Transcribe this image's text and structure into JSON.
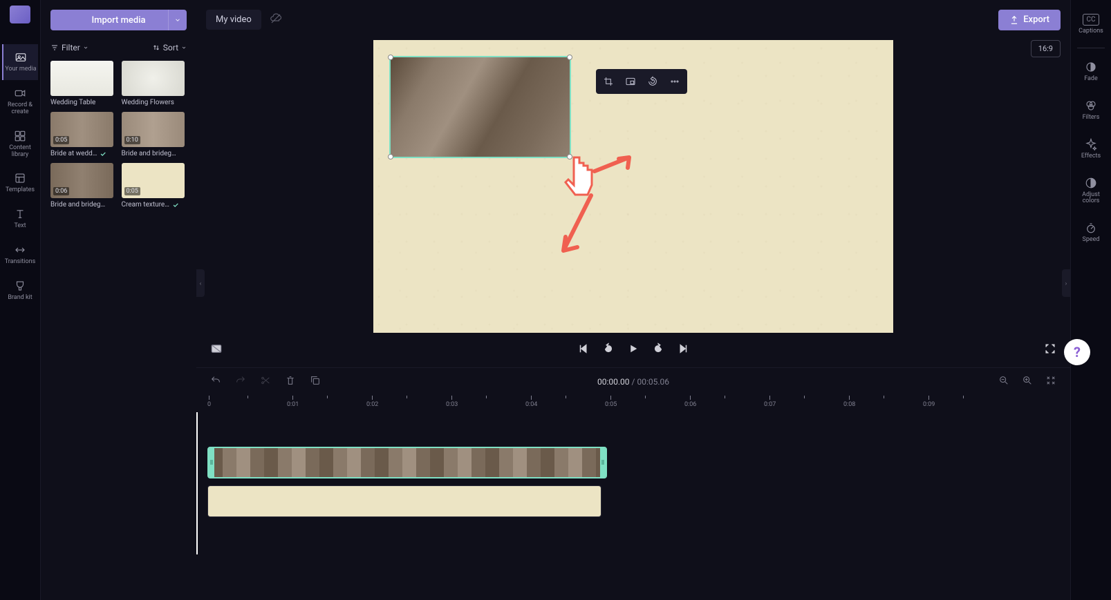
{
  "app": {
    "title": "My video"
  },
  "leftNav": {
    "items": [
      {
        "label": "Your media"
      },
      {
        "label": "Record & create"
      },
      {
        "label": "Content library"
      },
      {
        "label": "Templates"
      },
      {
        "label": "Text"
      },
      {
        "label": "Transitions"
      },
      {
        "label": "Brand kit"
      }
    ]
  },
  "mediaPanel": {
    "importLabel": "Import media",
    "filterLabel": "Filter",
    "sortLabel": "Sort",
    "items": [
      {
        "label": "Wedding Table",
        "duration": ""
      },
      {
        "label": "Wedding Flowers",
        "duration": ""
      },
      {
        "label": "Bride at wedd…",
        "duration": "0:05",
        "used": true
      },
      {
        "label": "Bride and brideg…",
        "duration": "0:10"
      },
      {
        "label": "Bride and brideg…",
        "duration": "0:06"
      },
      {
        "label": "Cream texture…",
        "duration": "0:05",
        "used": true
      }
    ]
  },
  "topBar": {
    "exportLabel": "Export",
    "aspectLabel": "16:9"
  },
  "playback": {
    "currentTime": "00:00.00",
    "separator": " / ",
    "totalTime": "00:05.06"
  },
  "ruler": {
    "ticks": [
      "0",
      "0:01",
      "0:02",
      "0:03",
      "0:04",
      "0:05",
      "0:06",
      "0:07",
      "0:08",
      "0:09"
    ]
  },
  "rightNav": {
    "items": [
      {
        "label": "Captions"
      },
      {
        "label": "Fade"
      },
      {
        "label": "Filters"
      },
      {
        "label": "Effects"
      },
      {
        "label": "Adjust colors"
      },
      {
        "label": "Speed"
      }
    ]
  }
}
